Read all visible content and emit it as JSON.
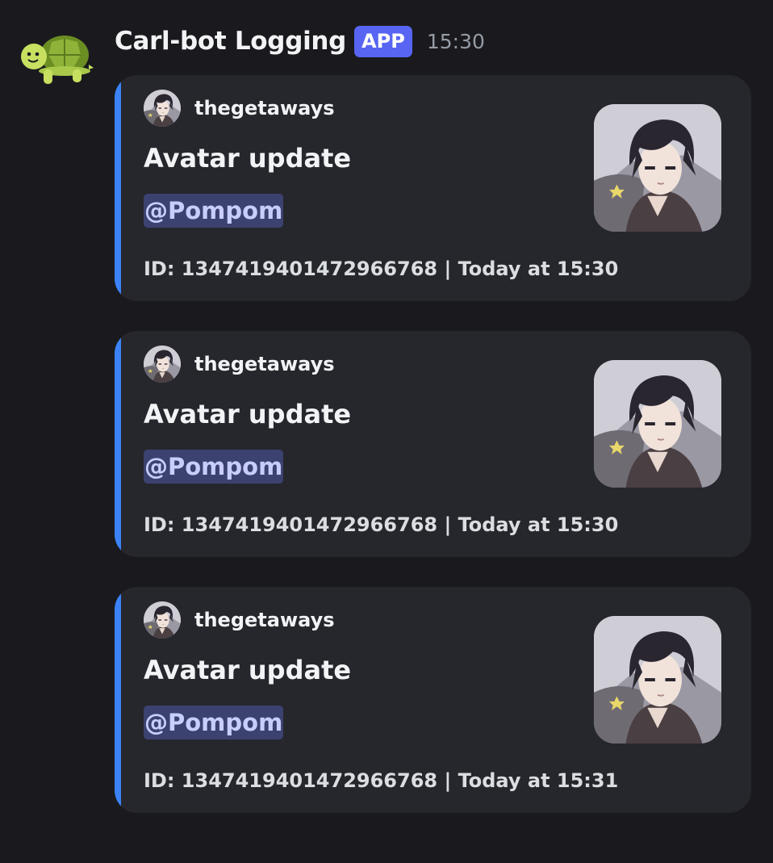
{
  "bot": {
    "avatar_icon": "turtle-icon",
    "name": "Carl-bot Logging",
    "badge": "APP",
    "time": "15:30"
  },
  "colors": {
    "embed_bar": "#3b82f6",
    "badge": "#5865f2",
    "mention_bg": "#3c4270",
    "mention_text": "#c9cdfb"
  },
  "embeds": [
    {
      "author": "thegetaways",
      "title": "Avatar update",
      "mention": "@Pompom",
      "footer": "ID: 1347419401472966768 | Today at 15:30"
    },
    {
      "author": "thegetaways",
      "title": "Avatar update",
      "mention": "@Pompom",
      "footer": "ID: 1347419401472966768 | Today at 15:30"
    },
    {
      "author": "thegetaways",
      "title": "Avatar update",
      "mention": "@Pompom",
      "footer": "ID: 1347419401472966768 | Today at 15:31"
    }
  ]
}
